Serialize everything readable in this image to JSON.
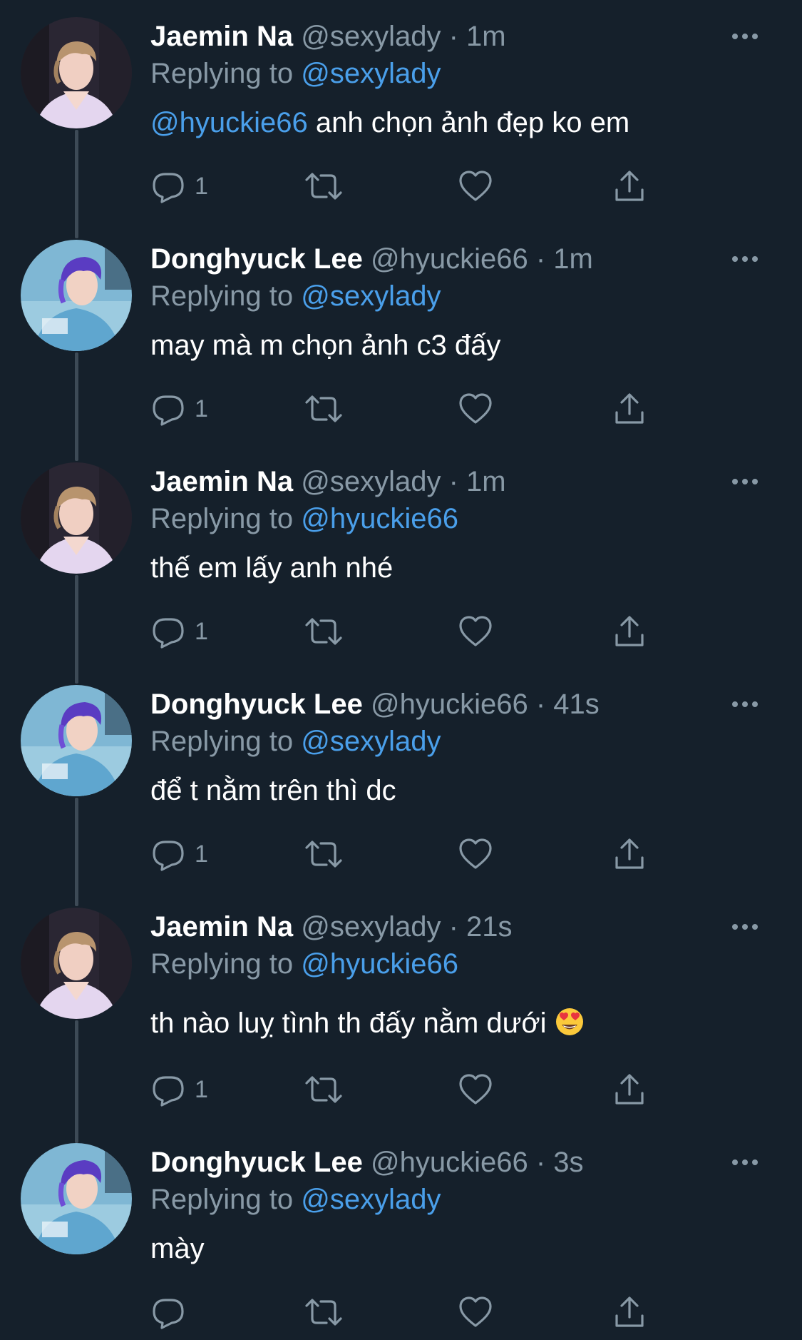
{
  "colors": {
    "background": "#15202b",
    "text_primary": "#ffffff",
    "text_secondary": "#8899a6",
    "link": "#4a9fea",
    "connector": "#3d4a56"
  },
  "tweets": [
    {
      "name": "Jaemin Na",
      "handle": "@sexylady",
      "dot": "·",
      "time": "1m",
      "replying_prefix": "Replying to",
      "replying_to": "@sexylady",
      "body_mention": "@hyuckie66",
      "body": " anh chọn ảnh đẹp ko em",
      "reply_count": "1",
      "avatar": "jaemin-avatar"
    },
    {
      "name": "Donghyuck Lee",
      "handle": "@hyuckie66",
      "dot": "·",
      "time": "1m",
      "replying_prefix": "Replying to",
      "replying_to": "@sexylady",
      "body_mention": "",
      "body": "may mà m chọn ảnh c3 đấy",
      "reply_count": "1",
      "avatar": "donghyuck-avatar"
    },
    {
      "name": "Jaemin Na",
      "handle": "@sexylady",
      "dot": "·",
      "time": "1m",
      "replying_prefix": "Replying to",
      "replying_to": "@hyuckie66",
      "body_mention": "",
      "body": "thế em lấy anh nhé",
      "reply_count": "1",
      "avatar": "jaemin-avatar"
    },
    {
      "name": "Donghyuck Lee",
      "handle": "@hyuckie66",
      "dot": "·",
      "time": "41s",
      "replying_prefix": "Replying to",
      "replying_to": "@sexylady",
      "body_mention": "",
      "body": "để t nằm trên thì dc",
      "reply_count": "1",
      "avatar": "donghyuck-avatar"
    },
    {
      "name": "Jaemin Na",
      "handle": "@sexylady",
      "dot": "·",
      "time": "21s",
      "replying_prefix": "Replying to",
      "replying_to": "@hyuckie66",
      "body_mention": "",
      "body": "th nào luỵ tình th đấy nằm dưới ",
      "reply_count": "1",
      "avatar": "jaemin-avatar",
      "emoji": "heart-eyes-emoji"
    },
    {
      "name": "Donghyuck Lee",
      "handle": "@hyuckie66",
      "dot": "·",
      "time": "3s",
      "replying_prefix": "Replying to",
      "replying_to": "@sexylady",
      "body_mention": "",
      "body": "mày",
      "reply_count": "",
      "avatar": "donghyuck-avatar"
    }
  ]
}
